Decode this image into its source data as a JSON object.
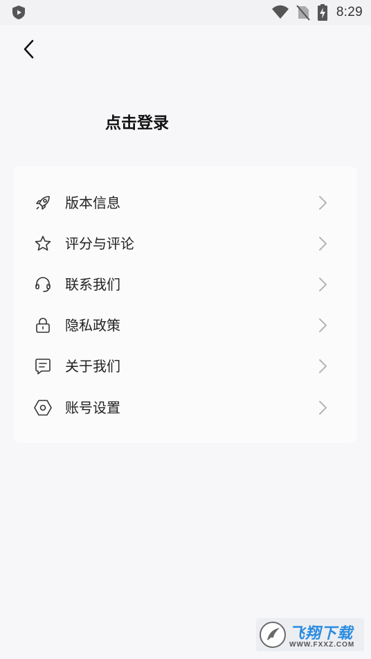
{
  "status_bar": {
    "time": "8:29",
    "icons": [
      "shield-play-icon",
      "wifi-icon",
      "no-sim-icon",
      "battery-charging-icon"
    ]
  },
  "nav": {
    "back_icon": "chevron-left-icon"
  },
  "header": {
    "login_label": "点击登录"
  },
  "menu": {
    "items": [
      {
        "label": "版本信息",
        "icon": "rocket-icon"
      },
      {
        "label": "评分与评论",
        "icon": "star-icon"
      },
      {
        "label": "联系我们",
        "icon": "headset-icon"
      },
      {
        "label": "隐私政策",
        "icon": "lock-icon"
      },
      {
        "label": "关于我们",
        "icon": "message-icon"
      },
      {
        "label": "账号设置",
        "icon": "hexagon-settings-icon"
      }
    ]
  },
  "watermark": {
    "title": "飞翔下载",
    "subtitle": "WWW.FXXZ.COM"
  },
  "colors": {
    "background": "#f7f7f9",
    "card": "#fbfbfc",
    "text": "#222222",
    "chevron": "#b5b5b5",
    "watermark_blue": "#2a8be0"
  }
}
